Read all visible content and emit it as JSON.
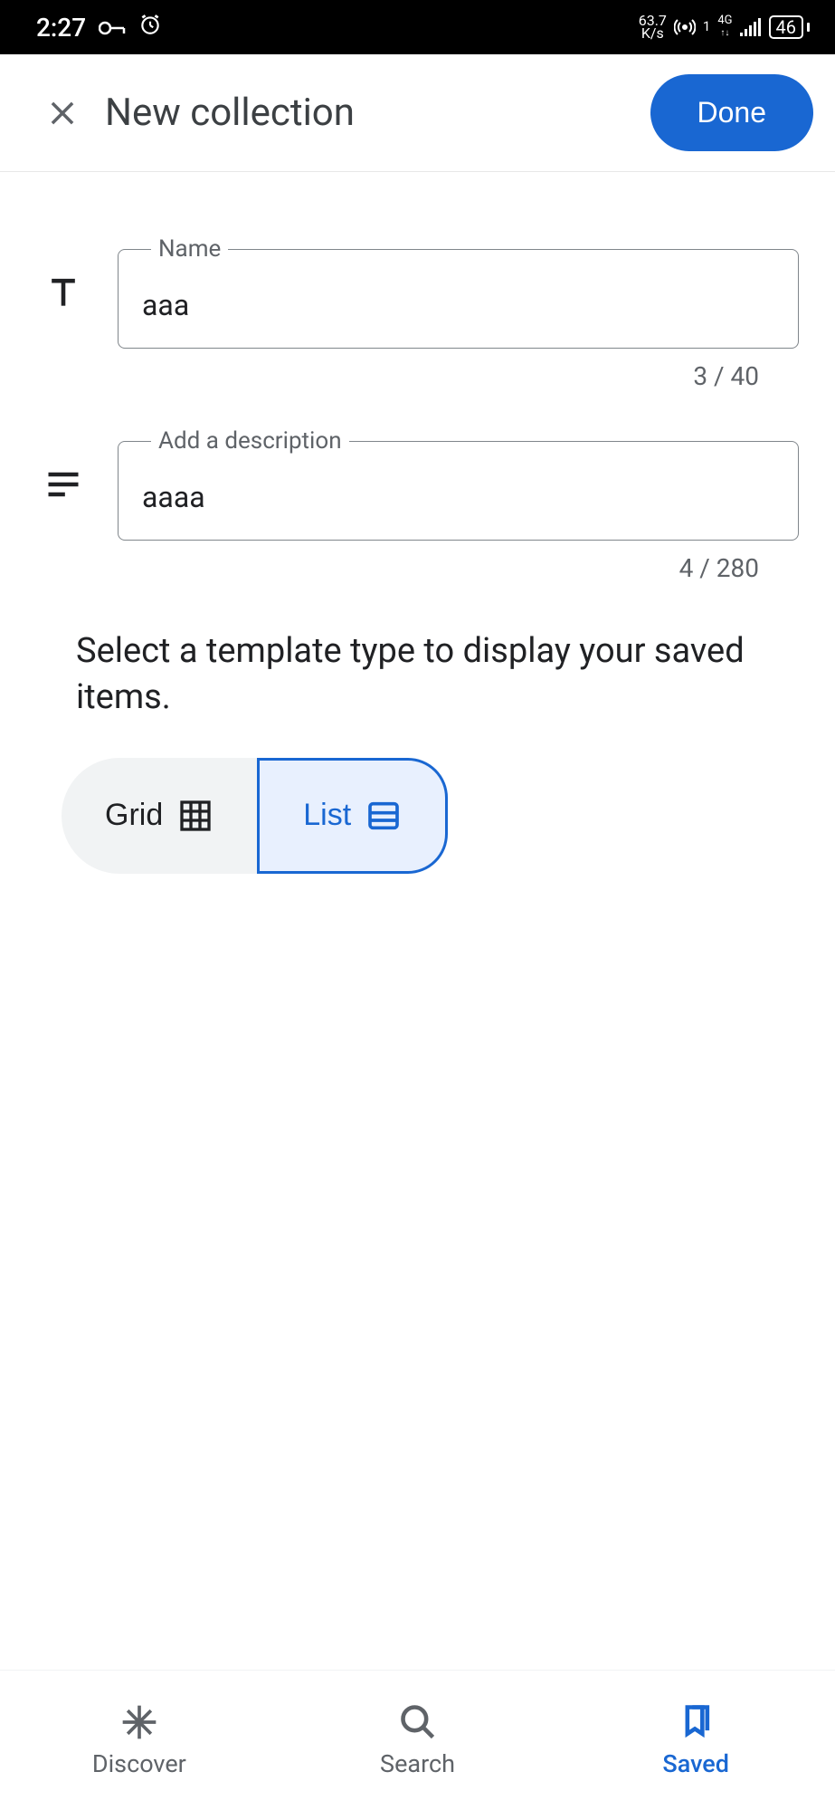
{
  "status_bar": {
    "time": "2:27",
    "network_speed_top": "63.7",
    "network_speed_bottom": "K/s",
    "sim": "1",
    "network_type": "4G",
    "battery": "46"
  },
  "header": {
    "title": "New collection",
    "done_label": "Done"
  },
  "name_field": {
    "label": "Name",
    "value": "aaa",
    "counter": "3 / 40"
  },
  "desc_field": {
    "label": "Add a description",
    "value": "aaaa",
    "counter": "4 / 280"
  },
  "template": {
    "prompt": "Select a template type to display your saved items.",
    "grid_label": "Grid",
    "list_label": "List"
  },
  "bottom_nav": {
    "discover": "Discover",
    "search": "Search",
    "saved": "Saved"
  }
}
